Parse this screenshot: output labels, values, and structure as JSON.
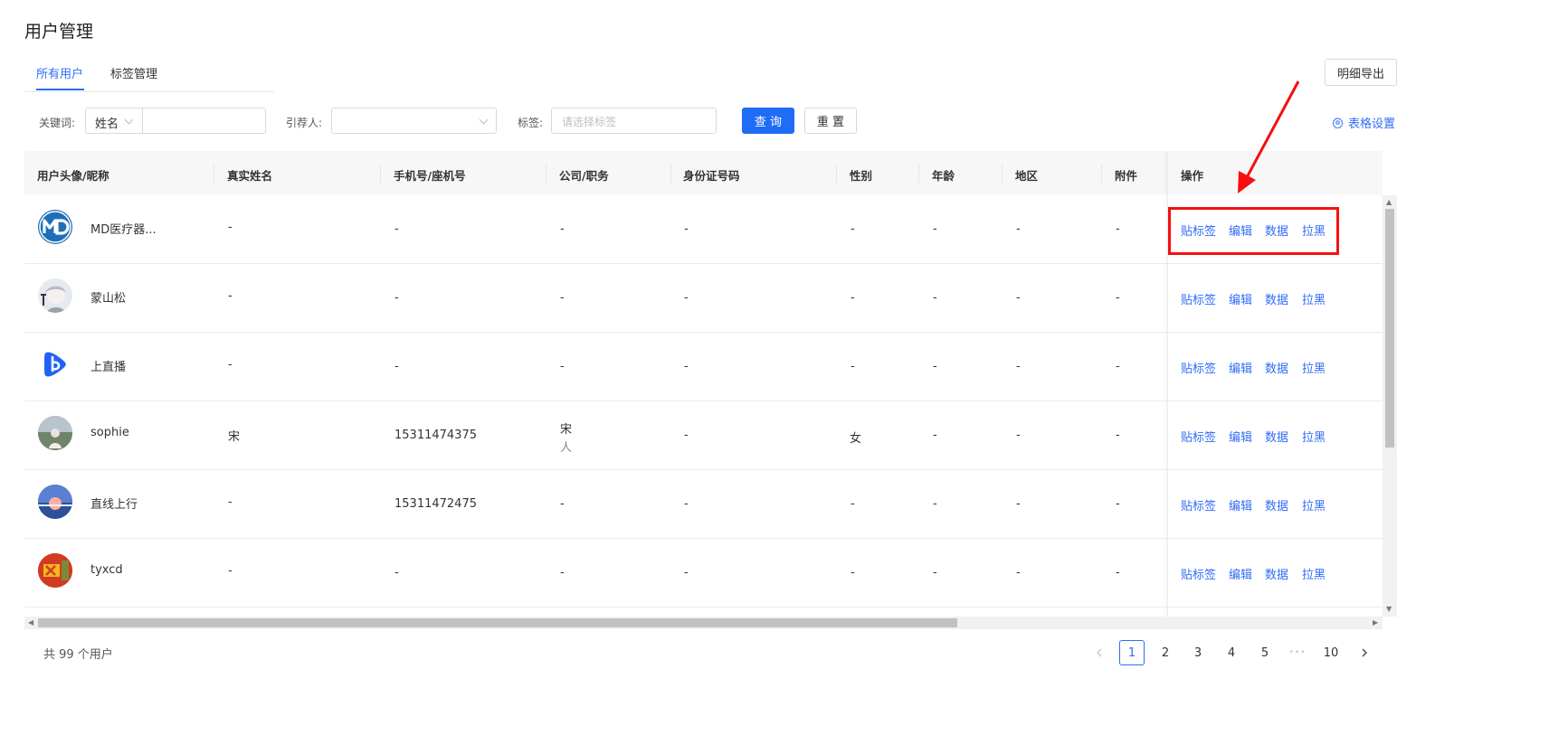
{
  "page": {
    "title": "用户管理"
  },
  "tabs": [
    {
      "label": "所有用户",
      "active": true
    },
    {
      "label": "标签管理",
      "active": false
    }
  ],
  "toolbar": {
    "export_label": "明细导出",
    "table_settings_label": "表格设置"
  },
  "filters": {
    "keyword_label": "关键词:",
    "keyword_type": "姓名",
    "keyword_value": "",
    "referrer_label": "引荐人:",
    "referrer_value": "",
    "tag_label": "标签:",
    "tag_placeholder": "请选择标签",
    "query_label": "查 询",
    "reset_label": "重 置"
  },
  "table": {
    "columns": [
      "用户头像/昵称",
      "真实姓名",
      "手机号/座机号",
      "公司/职务",
      "身份证号码",
      "性别",
      "年龄",
      "地区",
      "附件",
      "操作"
    ],
    "actions": [
      "贴标签",
      "编辑",
      "数据",
      "拉黑"
    ],
    "rows": [
      {
        "nickname": "MD医疗器...",
        "real_name": "-",
        "phone": "-",
        "company": "-",
        "position": "",
        "id_number": "-",
        "gender": "-",
        "age": "-",
        "region": "-",
        "attachment": "-",
        "avatar": "md-logo-icon"
      },
      {
        "nickname": "蒙山松",
        "real_name": "-",
        "phone": "-",
        "company": "-",
        "position": "",
        "id_number": "-",
        "gender": "-",
        "age": "-",
        "region": "-",
        "attachment": "-",
        "avatar": "anime-avatar-icon"
      },
      {
        "nickname": "上直播",
        "real_name": "-",
        "phone": "-",
        "company": "-",
        "position": "",
        "id_number": "-",
        "gender": "-",
        "age": "-",
        "region": "-",
        "attachment": "-",
        "avatar": "live-logo-icon"
      },
      {
        "nickname": "sophie",
        "real_name": "宋",
        "phone": "15311474375",
        "company": "宋",
        "position": "人",
        "id_number": "-",
        "gender": "女",
        "age": "-",
        "region": "-",
        "attachment": "-",
        "avatar": "photo-avatar-icon"
      },
      {
        "nickname": "直线上行",
        "real_name": "-",
        "phone": "15311472475",
        "company": "-",
        "position": "",
        "id_number": "-",
        "gender": "-",
        "age": "-",
        "region": "-",
        "attachment": "-",
        "avatar": "sunset-avatar-icon"
      },
      {
        "nickname": "tyxcd",
        "real_name": "-",
        "phone": "-",
        "company": "-",
        "position": "",
        "id_number": "-",
        "gender": "-",
        "age": "-",
        "region": "-",
        "attachment": "-",
        "avatar": "colorful-avatar-icon"
      }
    ]
  },
  "footer": {
    "total_text": "共 99 个用户",
    "pages": [
      "1",
      "2",
      "3",
      "4",
      "5",
      "10"
    ],
    "current_page": "1",
    "ellipsis": "•••",
    "prev_icon": "chevron-left-icon",
    "next_icon": "chevron-right-icon"
  },
  "colors": {
    "accent": "#2f6cf6",
    "primary_button": "#1f6cf6",
    "annotation": "#f50f0f"
  }
}
